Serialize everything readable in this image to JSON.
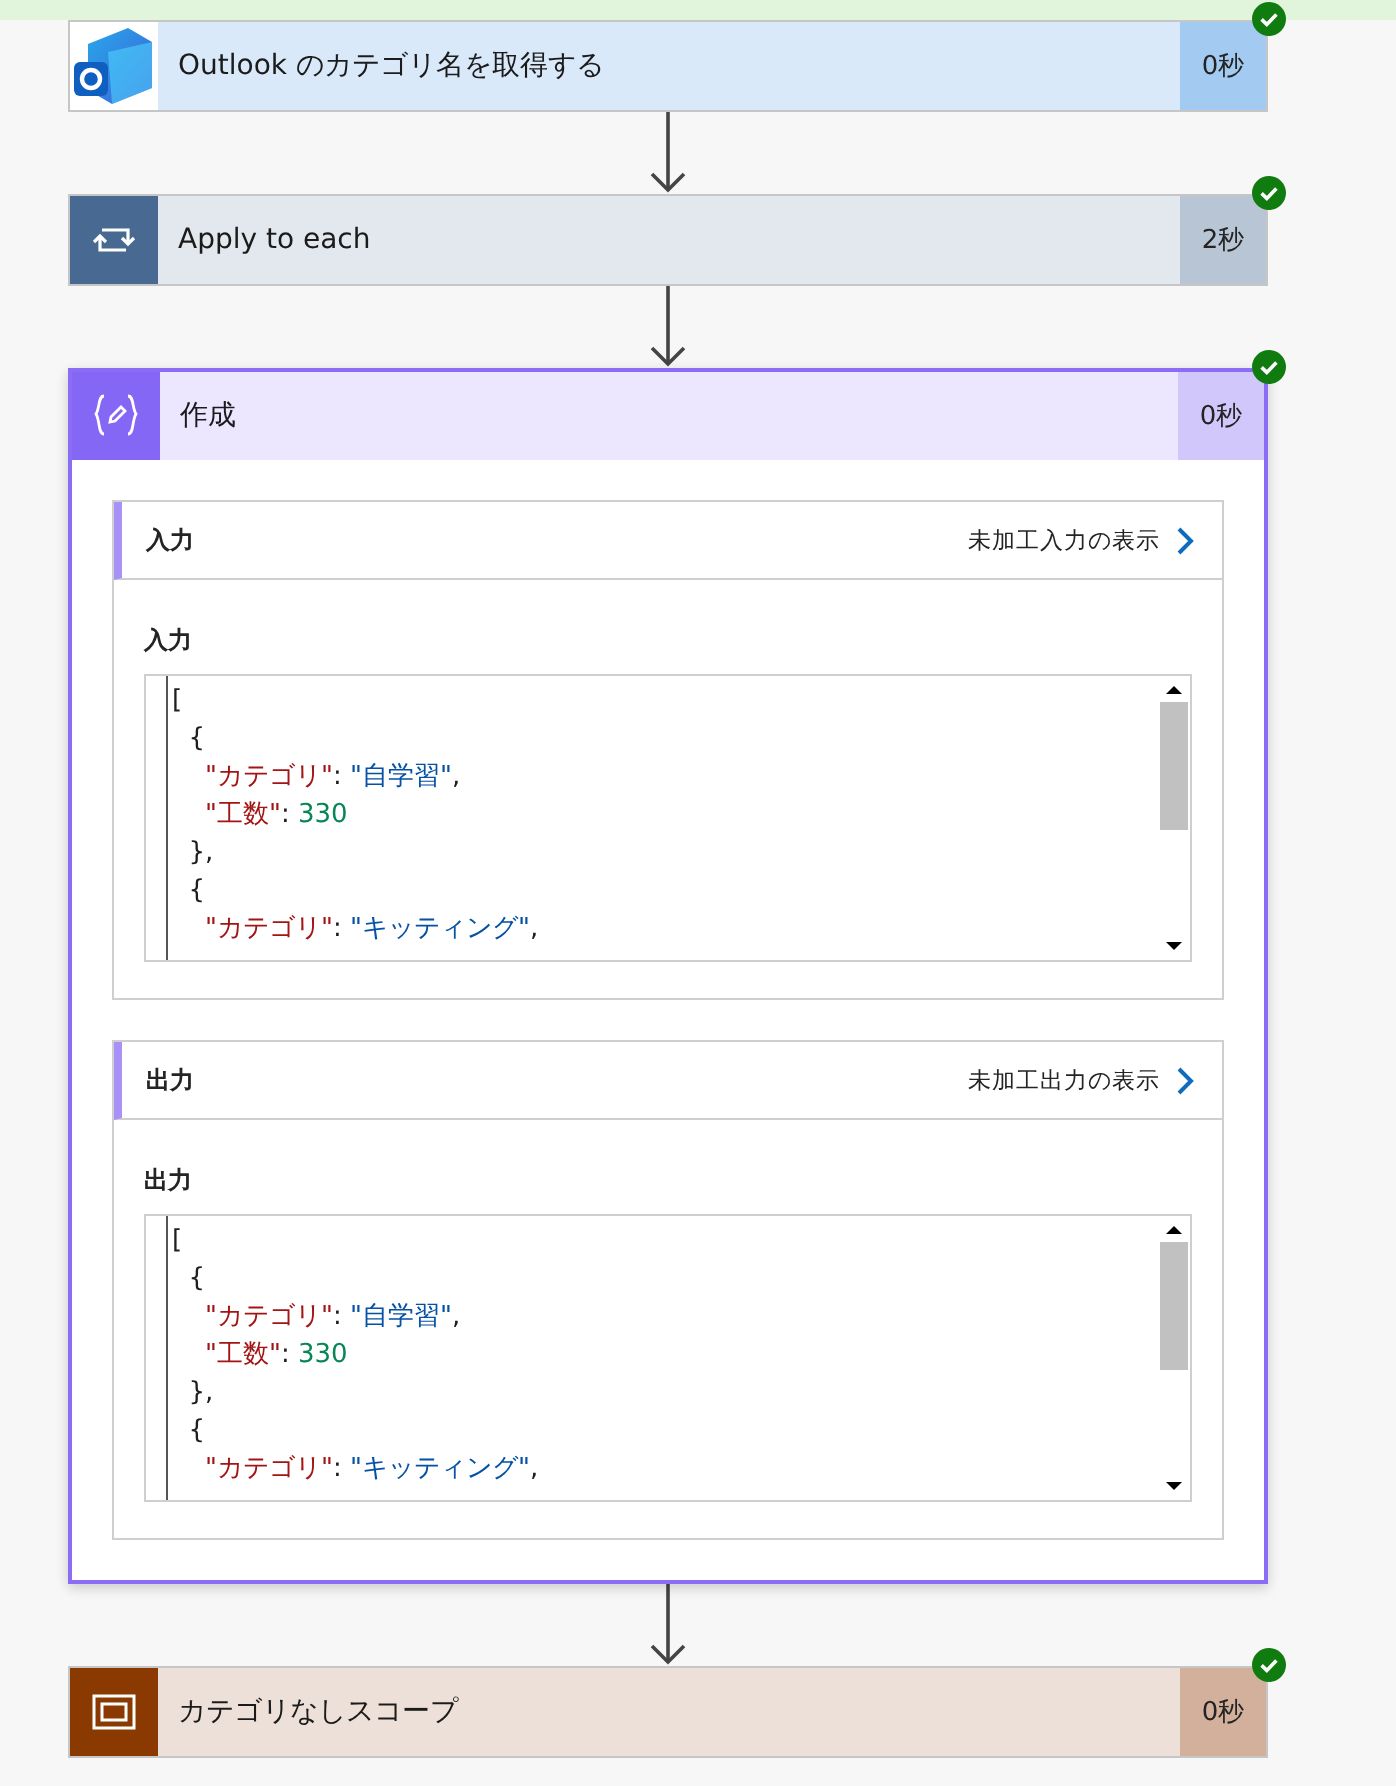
{
  "steps": [
    {
      "kind": "outlook",
      "title": "Outlook のカテゴリ名を取得する",
      "duration": "0秒",
      "succeeded": true
    },
    {
      "kind": "loop",
      "title": "Apply to each",
      "duration": "2秒",
      "succeeded": true
    },
    {
      "kind": "compose",
      "title": "作成",
      "duration": "0秒",
      "succeeded": true,
      "sections": [
        {
          "heading": "入力",
          "raw_link": "未加工入力の表示",
          "label": "入力",
          "code": [
            [
              {
                "kind": "punct",
                "text": "["
              }
            ],
            [
              {
                "kind": "punct",
                "text": "  {"
              }
            ],
            [
              {
                "kind": "key",
                "text": "    \"カテゴリ\""
              },
              {
                "kind": "punct",
                "text": ": "
              },
              {
                "kind": "string",
                "text": "\"自学習\""
              },
              {
                "kind": "punct",
                "text": ","
              }
            ],
            [
              {
                "kind": "key",
                "text": "    \"工数\""
              },
              {
                "kind": "punct",
                "text": ": "
              },
              {
                "kind": "number",
                "text": "330"
              }
            ],
            [
              {
                "kind": "punct",
                "text": "  },"
              }
            ],
            [
              {
                "kind": "punct",
                "text": "  {"
              }
            ],
            [
              {
                "kind": "key",
                "text": "    \"カテゴリ\""
              },
              {
                "kind": "punct",
                "text": ": "
              },
              {
                "kind": "string",
                "text": "\"キッティング\""
              },
              {
                "kind": "punct",
                "text": ","
              }
            ]
          ]
        },
        {
          "heading": "出力",
          "raw_link": "未加工出力の表示",
          "label": "出力",
          "code": [
            [
              {
                "kind": "punct",
                "text": "["
              }
            ],
            [
              {
                "kind": "punct",
                "text": "  {"
              }
            ],
            [
              {
                "kind": "key",
                "text": "    \"カテゴリ\""
              },
              {
                "kind": "punct",
                "text": ": "
              },
              {
                "kind": "string",
                "text": "\"自学習\""
              },
              {
                "kind": "punct",
                "text": ","
              }
            ],
            [
              {
                "kind": "key",
                "text": "    \"工数\""
              },
              {
                "kind": "punct",
                "text": ": "
              },
              {
                "kind": "number",
                "text": "330"
              }
            ],
            [
              {
                "kind": "punct",
                "text": "  },"
              }
            ],
            [
              {
                "kind": "punct",
                "text": "  {"
              }
            ],
            [
              {
                "kind": "key",
                "text": "    \"カテゴリ\""
              },
              {
                "kind": "punct",
                "text": ": "
              },
              {
                "kind": "string",
                "text": "\"キッティング\""
              },
              {
                "kind": "punct",
                "text": ","
              }
            ]
          ]
        }
      ]
    },
    {
      "kind": "scope",
      "title": "カテゴリなしスコープ",
      "duration": "0秒",
      "succeeded": true
    }
  ]
}
